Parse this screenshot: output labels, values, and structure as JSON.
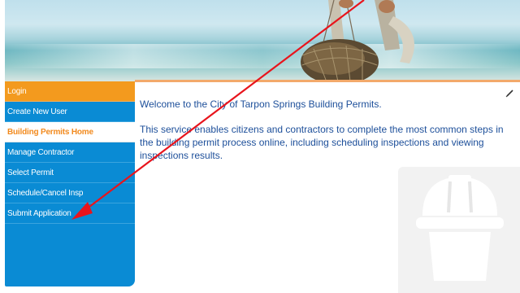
{
  "nav": {
    "items": [
      {
        "label": "Login",
        "state": "login"
      },
      {
        "label": "Create New User",
        "state": "normal"
      },
      {
        "label": "Building Permits Home",
        "state": "active"
      },
      {
        "label": "Manage Contractor",
        "state": "normal"
      },
      {
        "label": "Select Permit",
        "state": "normal"
      },
      {
        "label": "Schedule/Cancel Insp",
        "state": "normal"
      },
      {
        "label": "Submit Application",
        "state": "normal"
      }
    ]
  },
  "main": {
    "welcome": "Welcome to the City of Tarpon Springs Building Permits.",
    "description": "This service enables citizens and contractors to complete the most common steps in the building permit process online, including scheduling inspections and viewing inspections results."
  },
  "icons": {
    "edit": "pencil-icon",
    "hat": "hard-hat-icon"
  },
  "colors": {
    "nav_blue": "#0a8bd4",
    "login_orange": "#f39a1e",
    "active_text": "#f28a1e",
    "body_text": "#1d4f9a",
    "arrow_red": "#e8141c"
  }
}
